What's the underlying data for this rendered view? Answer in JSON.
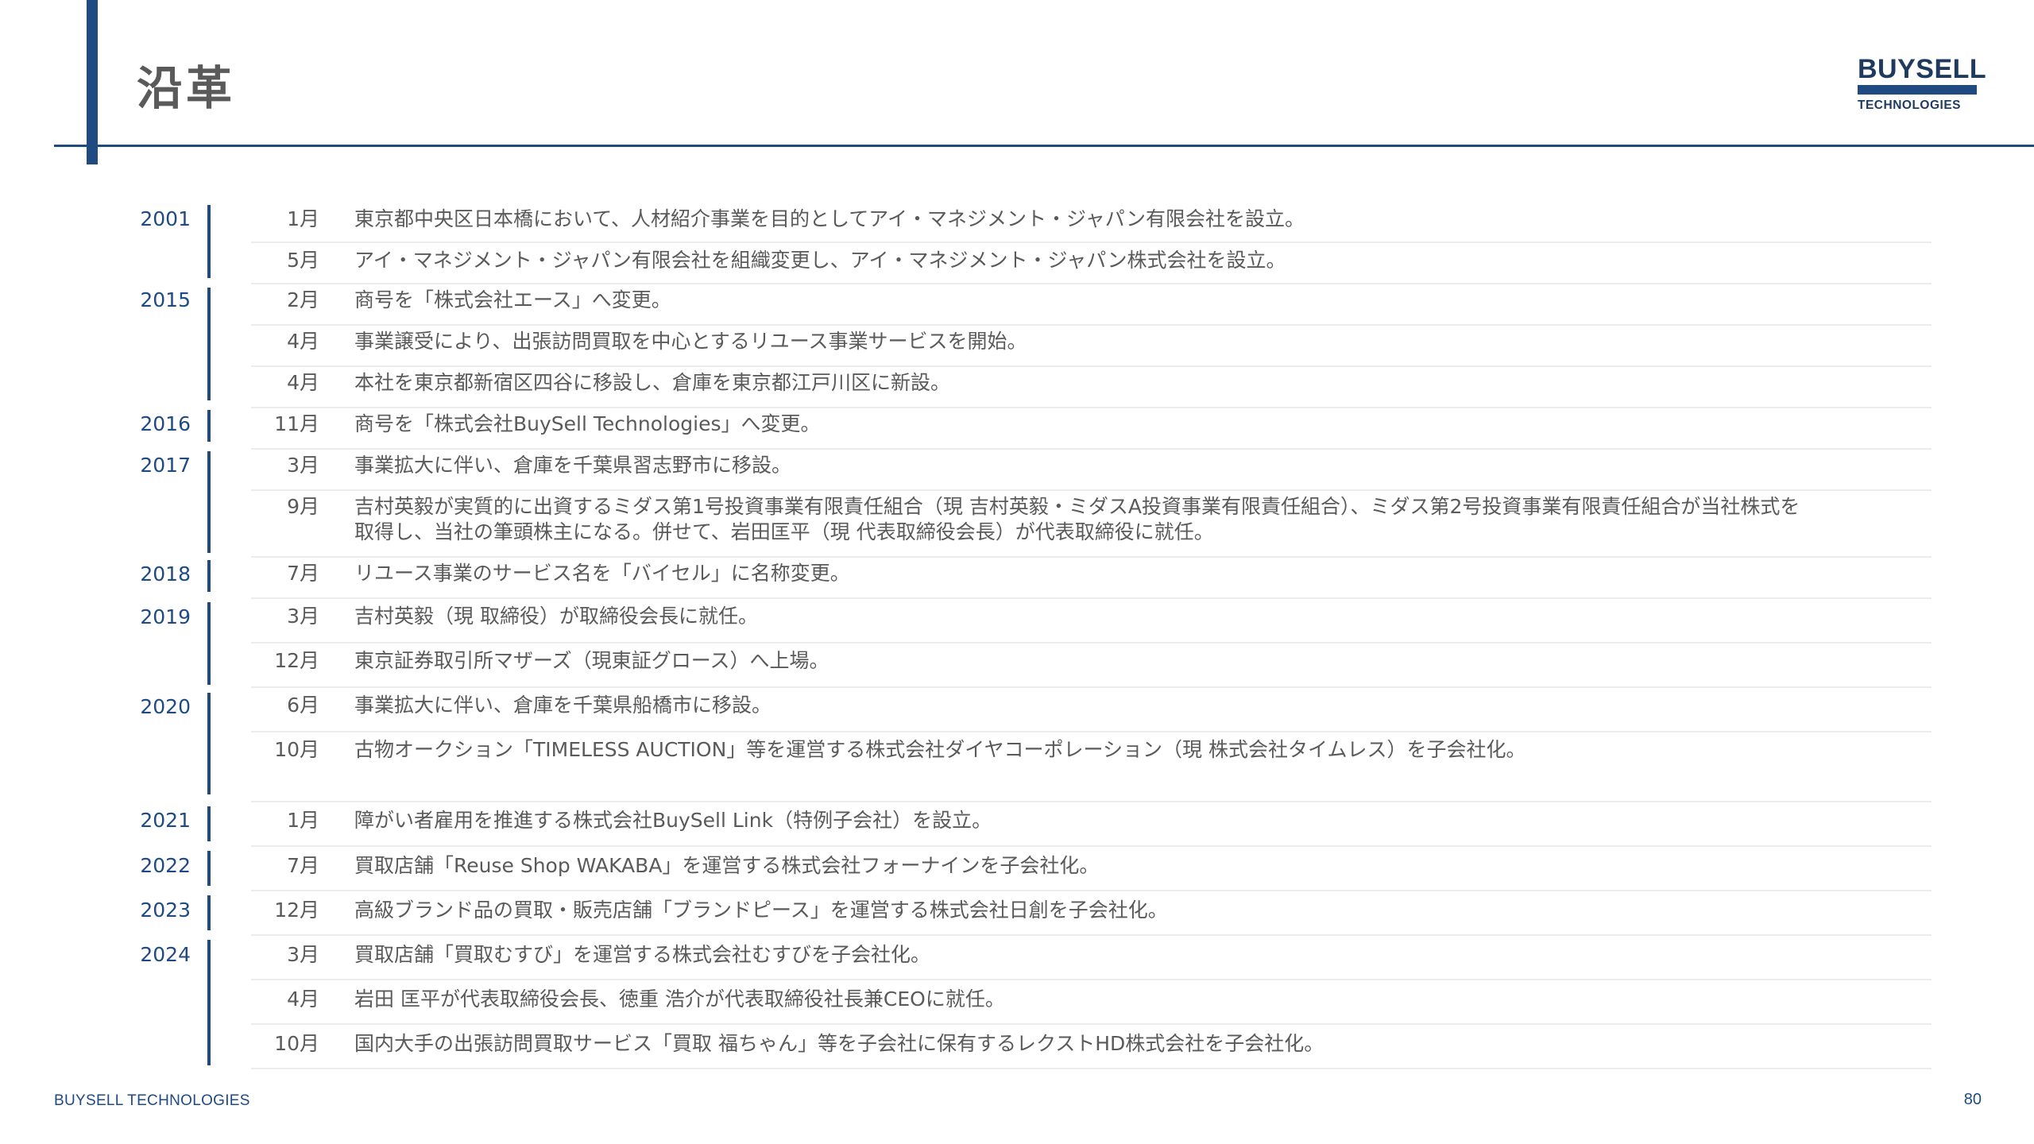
{
  "title": "沿革",
  "logo": {
    "line1": "BUYSELL",
    "line2": "TECHNOLOGIES"
  },
  "footer": {
    "brand": "BUYSELL  TECHNOLOGIES",
    "page_number": "80"
  },
  "years": [
    {
      "year": "2001"
    },
    {
      "year": "2015"
    },
    {
      "year": "2016"
    },
    {
      "year": "2017"
    },
    {
      "year": "2018"
    },
    {
      "year": "2019"
    },
    {
      "year": "2020"
    },
    {
      "year": "2021"
    },
    {
      "year": "2022"
    },
    {
      "year": "2023"
    },
    {
      "year": "2024"
    }
  ],
  "events": [
    {
      "month": "1月",
      "text": "東京都中央区日本橋において、人材紹介事業を目的としてアイ・マネジメント・ジャパン有限会社を設立。"
    },
    {
      "month": "5月",
      "text": "アイ・マネジメント・ジャパン有限会社を組織変更し、アイ・マネジメント・ジャパン株式会社を設立。"
    },
    {
      "month": "2月",
      "text": "商号を「株式会社エース」へ変更。"
    },
    {
      "month": "4月",
      "text": "事業譲受により、出張訪問買取を中心とするリユース事業サービスを開始。"
    },
    {
      "month": "4月",
      "text": "本社を東京都新宿区四谷に移設し、倉庫を東京都江戸川区に新設。"
    },
    {
      "month": "11月",
      "text": "商号を「株式会社BuySell Technologies」へ変更。"
    },
    {
      "month": "3月",
      "text": "事業拡大に伴い、倉庫を千葉県習志野市に移設。"
    },
    {
      "month": "9月",
      "text": "吉村英毅が実質的に出資するミダス第1号投資事業有限責任組合（現 吉村英毅・ミダスA投資事業有限責任組合）、ミダス第2号投資事業有限責任組合が当社株式を",
      "text2": "取得し、当社の筆頭株主になる。併せて、岩田匡平（現 代表取締役会長）が代表取締役に就任。"
    },
    {
      "month": "7月",
      "text": "リユース事業のサービス名を「バイセル」に名称変更。"
    },
    {
      "month": "3月",
      "text": "吉村英毅（現 取締役）が取締役会長に就任。"
    },
    {
      "month": "12月",
      "text": "東京証券取引所マザーズ（現東証グロース）へ上場。"
    },
    {
      "month": "6月",
      "text": "事業拡大に伴い、倉庫を千葉県船橋市に移設。"
    },
    {
      "month": "10月",
      "text": "古物オークション「TIMELESS AUCTION」等を運営する株式会社ダイヤコーポレーション（現 株式会社タイムレス）を子会社化。"
    },
    {
      "month": "1月",
      "text": "障がい者雇用を推進する株式会社BuySell Link（特例子会社）を設立。"
    },
    {
      "month": "7月",
      "text": "買取店舗「Reuse Shop WAKABA」を運営する株式会社フォーナインを子会社化。"
    },
    {
      "month": "12月",
      "text": "高級ブランド品の買取・販売店舗「ブランドピース」を運営する株式会社日創を子会社化。"
    },
    {
      "month": "3月",
      "text": "買取店舗「買取むすび」を運営する株式会社むすびを子会社化。"
    },
    {
      "month": "4月",
      "text": "岩田 匡平が代表取締役会長、徳重 浩介が代表取締役社長兼CEOに就任。"
    },
    {
      "month": "10月",
      "text": "国内大手の出張訪問買取サービス「買取 福ちゃん」等を子会社に保有するレクストHD株式会社を子会社化。"
    }
  ]
}
